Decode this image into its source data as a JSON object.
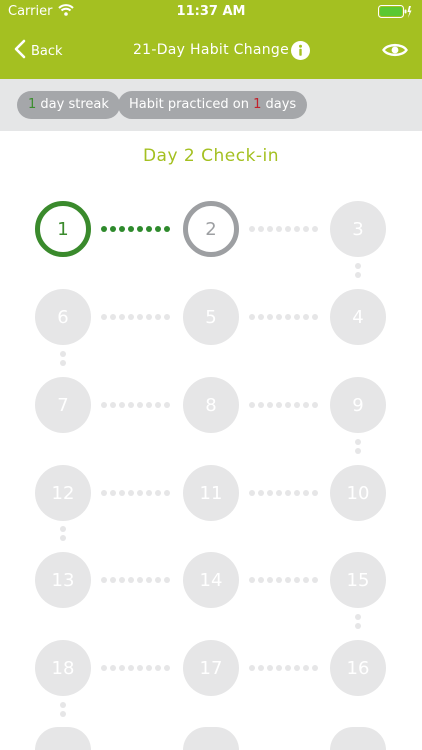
{
  "status_bar": {
    "carrier": "Carrier",
    "time": "11:37 AM"
  },
  "nav": {
    "back_label": "Back",
    "title": "21-Day Habit Change"
  },
  "chips": {
    "streak": {
      "count": "1",
      "text": " day streak"
    },
    "practiced": {
      "prefix": "Habit practiced on ",
      "count": "1",
      "suffix": " days"
    }
  },
  "checkin_title": "Day 2 Check-in",
  "days": {
    "d1": "1",
    "d2": "2",
    "d3": "3",
    "d4": "4",
    "d5": "5",
    "d6": "6",
    "d7": "7",
    "d8": "8",
    "d9": "9",
    "d10": "10",
    "d11": "11",
    "d12": "12",
    "d13": "13",
    "d14": "14",
    "d15": "15",
    "d16": "16",
    "d17": "17",
    "d18": "18"
  },
  "colors": {
    "accent": "#a4c021",
    "completed": "#3a8a2c",
    "current": "#9d9fa2",
    "locked": "#e6e6e7",
    "streak_number": "#3b8d2e",
    "practiced_number": "#c2212b"
  },
  "icons": [
    "wifi-icon",
    "battery-icon",
    "back-chevron-icon",
    "info-icon",
    "eye-icon"
  ]
}
